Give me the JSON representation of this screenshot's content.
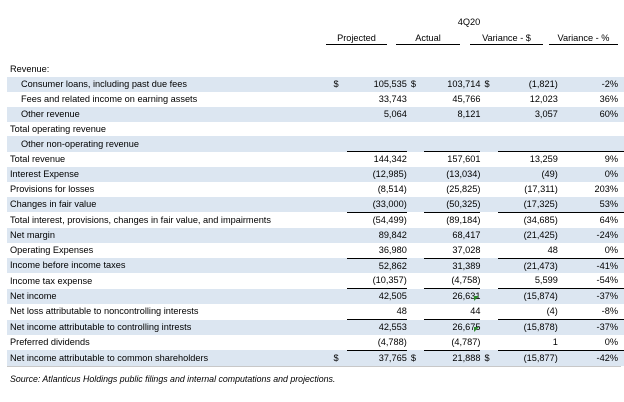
{
  "period": "4Q20",
  "columns": [
    "Projected",
    "Actual",
    "Variance - $",
    "Variance - %"
  ],
  "rows": [
    {
      "label": "Revenue:",
      "indent": false,
      "shade": false,
      "cur": [
        "",
        "",
        ""
      ],
      "vals": [
        "",
        "",
        "",
        ""
      ]
    },
    {
      "label": "Consumer loans, including past due fees",
      "indent": true,
      "shade": true,
      "cur": [
        "$",
        "$",
        "$"
      ],
      "vals": [
        "105,535",
        "103,714",
        "(1,821)",
        "-2%"
      ]
    },
    {
      "label": "Fees and related income on earning assets",
      "indent": true,
      "shade": false,
      "cur": [
        "",
        "",
        ""
      ],
      "vals": [
        "33,743",
        "45,766",
        "12,023",
        "36%"
      ]
    },
    {
      "label": "Other revenue",
      "indent": true,
      "shade": true,
      "cur": [
        "",
        "",
        ""
      ],
      "vals": [
        "5,064",
        "8,121",
        "3,057",
        "60%"
      ]
    },
    {
      "label": "Total operating revenue",
      "indent": false,
      "shade": false,
      "cur": [
        "",
        "",
        ""
      ],
      "vals": [
        "",
        "",
        "",
        ""
      ]
    },
    {
      "label": "Other non-operating revenue",
      "indent": true,
      "shade": true,
      "cur": [
        "",
        "",
        ""
      ],
      "vals": [
        "",
        "",
        "",
        ""
      ]
    },
    {
      "label": "Total revenue",
      "indent": false,
      "shade": false,
      "cur": [
        "",
        "",
        ""
      ],
      "vals": [
        "144,342",
        "157,601",
        "13,259",
        "9%"
      ],
      "topBorder": true
    },
    {
      "label": "Interest Expense",
      "indent": false,
      "shade": true,
      "cur": [
        "",
        "",
        ""
      ],
      "vals": [
        "(12,985)",
        "(13,034)",
        "(49)",
        "0%"
      ]
    },
    {
      "label": "Provisions for losses",
      "indent": false,
      "shade": false,
      "cur": [
        "",
        "",
        ""
      ],
      "vals": [
        "(8,514)",
        "(25,825)",
        "(17,311)",
        "203%"
      ]
    },
    {
      "label": "Changes in fair value",
      "indent": false,
      "shade": true,
      "cur": [
        "",
        "",
        ""
      ],
      "vals": [
        "(33,000)",
        "(50,325)",
        "(17,325)",
        "53%"
      ]
    },
    {
      "label": "Total interest, provisions, changes in fair value, and impairments",
      "indent": false,
      "shade": false,
      "cur": [
        "",
        "",
        ""
      ],
      "vals": [
        "(54,499)",
        "(89,184)",
        "(34,685)",
        "64%"
      ],
      "topBorder": true
    },
    {
      "label": "Net margin",
      "indent": false,
      "shade": true,
      "cur": [
        "",
        "",
        ""
      ],
      "vals": [
        "89,842",
        "68,417",
        "(21,425)",
        "-24%"
      ]
    },
    {
      "label": "Operating Expenses",
      "indent": false,
      "shade": false,
      "cur": [
        "",
        "",
        ""
      ],
      "vals": [
        "36,980",
        "37,028",
        "48",
        "0%"
      ]
    },
    {
      "label": "Income before income taxes",
      "indent": false,
      "shade": true,
      "cur": [
        "",
        "",
        ""
      ],
      "vals": [
        "52,862",
        "31,389",
        "(21,473)",
        "-41%"
      ],
      "topBorder": true
    },
    {
      "label": "Income tax expense",
      "indent": false,
      "shade": false,
      "cur": [
        "",
        "",
        ""
      ],
      "vals": [
        "(10,357)",
        "(4,758)",
        "5,599",
        "-54%"
      ]
    },
    {
      "label": "Net income",
      "indent": false,
      "shade": true,
      "cur": [
        "",
        "",
        ""
      ],
      "vals": [
        "42,505",
        "26,631",
        "(15,874)",
        "-37%"
      ],
      "topBorder": true
    },
    {
      "label": "Net loss attributable to noncontrolling interests",
      "indent": false,
      "shade": false,
      "cur": [
        "",
        "",
        ""
      ],
      "vals": [
        "48",
        "44",
        "(4)",
        "-8%"
      ]
    },
    {
      "label": "Net income attributable to controlling intrests",
      "indent": false,
      "shade": true,
      "cur": [
        "",
        "",
        ""
      ],
      "vals": [
        "42,553",
        "26,675",
        "(15,878)",
        "-37%"
      ],
      "topBorder": true
    },
    {
      "label": "Preferred dividends",
      "indent": false,
      "shade": false,
      "cur": [
        "",
        "",
        ""
      ],
      "vals": [
        "(4,788)",
        "(4,787)",
        "1",
        "0%"
      ]
    },
    {
      "label": "Net income attributable to common shareholders",
      "indent": false,
      "shade": true,
      "cur": [
        "$",
        "$",
        "$"
      ],
      "vals": [
        "37,765",
        "21,888",
        "(15,877)",
        "-42%"
      ],
      "topBorder": true
    }
  ],
  "source": "Source: Atlanticus Holdings public filings and internal computations and projections.",
  "colors": {
    "shade": "#dce6f1",
    "flag": "#2e8b2e"
  }
}
